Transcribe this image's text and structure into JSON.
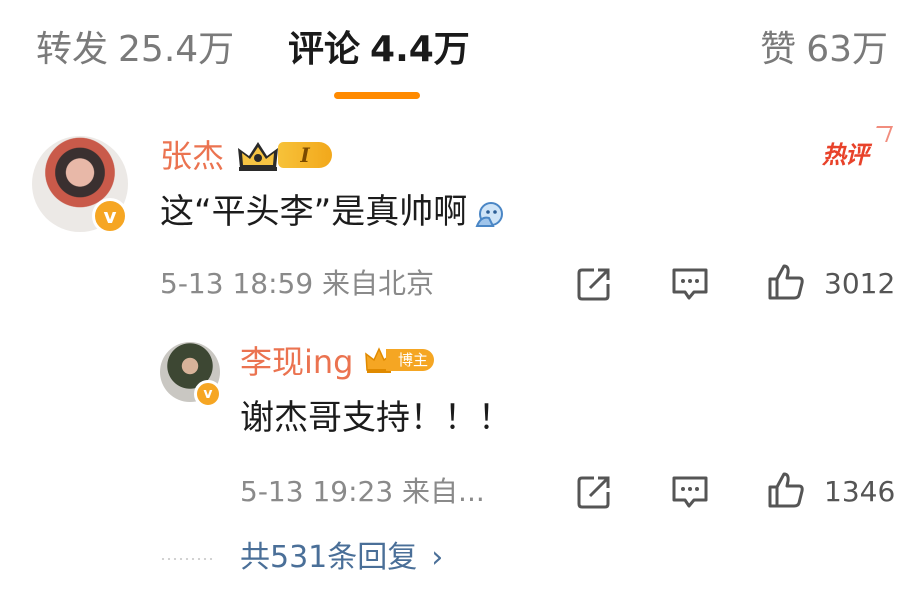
{
  "tabs": {
    "repost": {
      "label": "转发",
      "count": "25.4万"
    },
    "comments": {
      "label": "评论",
      "count": "4.4万"
    },
    "likes": {
      "label": "赞",
      "count": "63万"
    }
  },
  "comment": {
    "username": "张杰",
    "level": "I",
    "hot_label": "热评",
    "text": "这“平头李”是真帅啊",
    "meta": "5-13 18:59 来自北京",
    "like_count": "3012"
  },
  "reply": {
    "username": "李现ing",
    "badge": "博主",
    "text": "谢杰哥支持！！！",
    "meta": "5-13 19:23 来自...",
    "like_count": "1346"
  },
  "more_replies": "共531条回复",
  "colors": {
    "accent": "#ff8a00",
    "username": "#eb7350",
    "link": "#4a6f98",
    "hot": "#e8422a"
  }
}
